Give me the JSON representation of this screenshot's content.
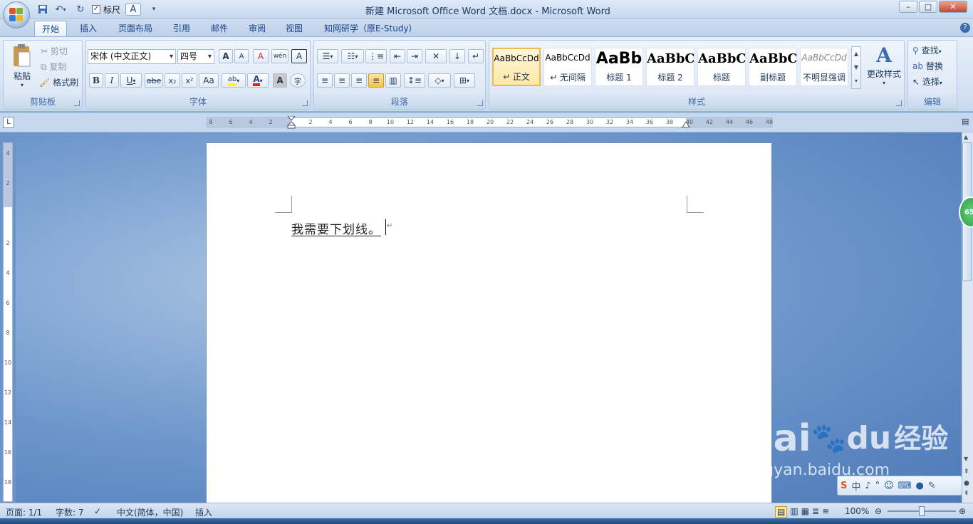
{
  "window": {
    "title": "新建 Microsoft Office Word 文档.docx - Microsoft Word",
    "minimize": "–",
    "maximize": "□",
    "close": "✕"
  },
  "quick_access": {
    "ruler_checkbox_label": "标尺",
    "ruler_checked": true
  },
  "tabs": [
    "开始",
    "插入",
    "页面布局",
    "引用",
    "邮件",
    "审阅",
    "视图",
    "知网研学（原E-Study）"
  ],
  "active_tab": "开始",
  "clipboard": {
    "label": "剪贴板",
    "paste": "粘贴",
    "cut": "剪切",
    "copy": "复制",
    "format_painter": "格式刷"
  },
  "font": {
    "label": "字体",
    "family": "宋体 (中文正文)",
    "size": "四号",
    "grow": "A",
    "shrink": "A",
    "phonetic": "wén",
    "bold": "B",
    "italic": "I",
    "underline": "U",
    "strike": "abe",
    "subscript": "x₂",
    "superscript": "x²",
    "change_case": "Aa",
    "highlight": "ab",
    "font_color": "A",
    "char_shading": "A",
    "enclose": "字",
    "clear_format": "A",
    "font_color_hex": "#e02020",
    "highlight_hex": "#ffff00"
  },
  "paragraph": {
    "label": "段落"
  },
  "styles": {
    "label": "样式",
    "items": [
      {
        "preview": "AaBbCcDd",
        "name": "↵ 正文",
        "selected": true
      },
      {
        "preview": "AaBbCcDd",
        "name": "↵ 无间隔",
        "selected": false
      },
      {
        "preview": "AaBb",
        "name": "标题 1",
        "selected": false
      },
      {
        "preview": "AaBbC",
        "name": "标题 2",
        "selected": false
      },
      {
        "preview": "AaBbC",
        "name": "标题",
        "selected": false
      },
      {
        "preview": "AaBbC",
        "name": "副标题",
        "selected": false
      },
      {
        "preview": "AaBbCcDd",
        "name": "不明显强调",
        "selected": false
      }
    ],
    "change_styles": "更改样式"
  },
  "editing": {
    "label": "编辑",
    "find": "查找",
    "replace": "替换",
    "select": "选择"
  },
  "ruler": {
    "h_ticks": [
      "8",
      "6",
      "4",
      "2",
      "",
      "2",
      "4",
      "6",
      "8",
      "10",
      "12",
      "14",
      "16",
      "18",
      "20",
      "22",
      "24",
      "26",
      "28",
      "30",
      "32",
      "34",
      "36",
      "38",
      "40",
      "42",
      "44",
      "46",
      "48"
    ],
    "v_ticks": [
      "4",
      "2",
      "",
      "2",
      "4",
      "6",
      "8",
      "10",
      "12",
      "14",
      "16",
      "18"
    ]
  },
  "document": {
    "text": "我需要下划线。",
    "paragraph_mark": "↵"
  },
  "scroll_badge": "65",
  "status": {
    "page": "页面: 1/1",
    "words": "字数: 7",
    "language": "中文(简体，中国)",
    "mode": "插入",
    "zoom": "100%"
  },
  "watermark": {
    "brand": "Bai",
    "brand_du": "du",
    "jingyan": "经验",
    "url": "jingyan.baidu.com"
  },
  "ime": {
    "mode": "中"
  }
}
